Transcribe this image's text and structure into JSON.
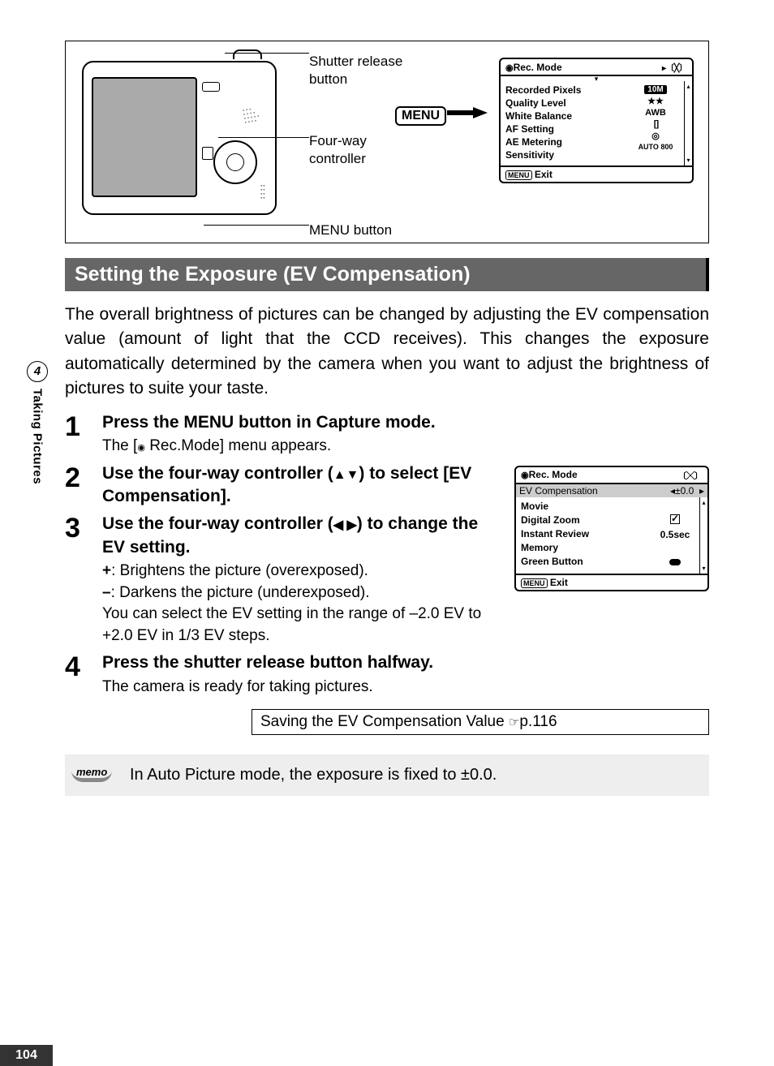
{
  "page_number": "104",
  "side_tab": {
    "number": "4",
    "label": "Taking Pictures"
  },
  "diagram": {
    "shutter_label_l1": "Shutter release",
    "shutter_label_l2": "button",
    "fourway_label_l1": "Four-way",
    "fourway_label_l2": "controller",
    "menu_label": "MENU button",
    "menu_chip": "MENU"
  },
  "lcd1": {
    "tab_active": "Rec. Mode",
    "rows": {
      "r1": "Recorded Pixels",
      "v1": "10M",
      "r2": "Quality Level",
      "v2": "★★",
      "r3": "White Balance",
      "v3": "AWB",
      "r4": "AF Setting",
      "v4": "[   ]",
      "r5": "AE Metering",
      "v5": "◎",
      "r6": "Sensitivity",
      "v6": "AUTO 800"
    },
    "exit_btn": "MENU",
    "exit_label": "Exit"
  },
  "heading": "Setting the Exposure (EV Compensation)",
  "intro": "The overall brightness of pictures can be changed by adjusting the EV compensation value (amount of light that the CCD receives). This changes the exposure automatically determined by the camera when you want to adjust the brightness of pictures to suite your taste.",
  "steps": {
    "s1_title": "Press the MENU button in Capture mode.",
    "s1_sub_a": "The [",
    "s1_sub_b": " Rec.Mode] menu appears.",
    "s2_title_a": "Use the four-way controller (",
    "s2_title_b": ") to select [EV Compensation].",
    "s3_title_a": "Use the four-way controller (",
    "s3_title_b": ") to change the EV setting.",
    "s3_plus": "+",
    "s3_plus_text": ": Brightens the picture (overexposed).",
    "s3_minus": "–",
    "s3_minus_text": ": Darkens the picture (underexposed).",
    "s3_range": "You can select the EV setting in the range of –2.0 EV to +2.0 EV in 1/3 EV steps.",
    "s4_title": "Press the shutter release button halfway.",
    "s4_sub": "The camera is ready for taking pictures."
  },
  "lcd2": {
    "tab_active": "Rec. Mode",
    "hl_label": "EV Compensation",
    "hl_value": "±0.0",
    "rows": {
      "r1": "Movie",
      "r2": "Digital Zoom",
      "v2": "check",
      "r3": "Instant Review",
      "v3": "0.5sec",
      "r4": "Memory",
      "r5": "Green Button",
      "v5": "dot"
    },
    "exit_btn": "MENU",
    "exit_label": "Exit"
  },
  "link_box": {
    "text": "Saving the EV Compensation Value ",
    "page": "p.116"
  },
  "memo": {
    "label": "memo",
    "text": "In Auto Picture mode, the exposure is fixed to ±0.0."
  }
}
